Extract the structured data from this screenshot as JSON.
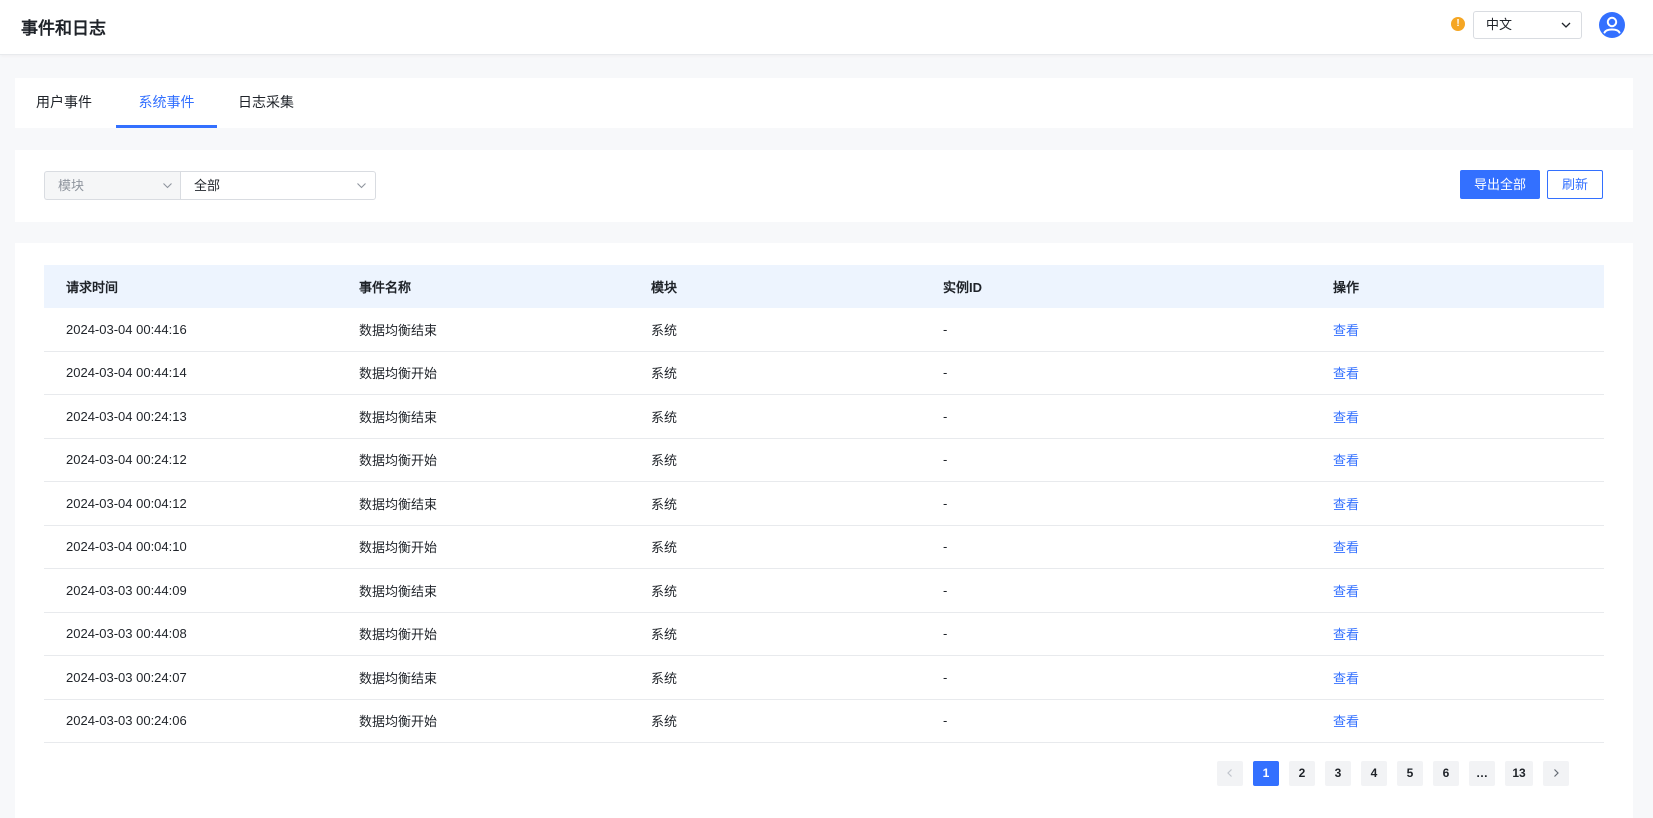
{
  "header": {
    "title": "事件和日志",
    "language": "中文"
  },
  "tabs": [
    {
      "label": "用户事件"
    },
    {
      "label": "系统事件"
    },
    {
      "label": "日志采集"
    }
  ],
  "filters": {
    "module_label": "模块",
    "module_value": "全部"
  },
  "actions": {
    "export_all": "导出全部",
    "refresh": "刷新"
  },
  "table": {
    "columns": [
      "请求时间",
      "事件名称",
      "模块",
      "实例ID",
      "操作"
    ],
    "rows": [
      {
        "time": "2024-03-04 00:44:16",
        "event": "数据均衡结束",
        "module": "系统",
        "instance": "-",
        "action": "查看"
      },
      {
        "time": "2024-03-04 00:44:14",
        "event": "数据均衡开始",
        "module": "系统",
        "instance": "-",
        "action": "查看"
      },
      {
        "time": "2024-03-04 00:24:13",
        "event": "数据均衡结束",
        "module": "系统",
        "instance": "-",
        "action": "查看"
      },
      {
        "time": "2024-03-04 00:24:12",
        "event": "数据均衡开始",
        "module": "系统",
        "instance": "-",
        "action": "查看"
      },
      {
        "time": "2024-03-04 00:04:12",
        "event": "数据均衡结束",
        "module": "系统",
        "instance": "-",
        "action": "查看"
      },
      {
        "time": "2024-03-04 00:04:10",
        "event": "数据均衡开始",
        "module": "系统",
        "instance": "-",
        "action": "查看"
      },
      {
        "time": "2024-03-03 00:44:09",
        "event": "数据均衡结束",
        "module": "系统",
        "instance": "-",
        "action": "查看"
      },
      {
        "time": "2024-03-03 00:44:08",
        "event": "数据均衡开始",
        "module": "系统",
        "instance": "-",
        "action": "查看"
      },
      {
        "time": "2024-03-03 00:24:07",
        "event": "数据均衡结束",
        "module": "系统",
        "instance": "-",
        "action": "查看"
      },
      {
        "time": "2024-03-03 00:24:06",
        "event": "数据均衡开始",
        "module": "系统",
        "instance": "-",
        "action": "查看"
      }
    ]
  },
  "pagination": {
    "pages": [
      "1",
      "2",
      "3",
      "4",
      "5",
      "6",
      "…",
      "13"
    ],
    "current": "1"
  },
  "colors": {
    "accent": "#3370ff",
    "warning": "#f5a623",
    "header_bg": "#edf4fe"
  },
  "icons": {
    "warning": "warning-icon",
    "user": "user-avatar-icon",
    "prev": "chevron-left-icon",
    "next": "chevron-right-icon"
  }
}
